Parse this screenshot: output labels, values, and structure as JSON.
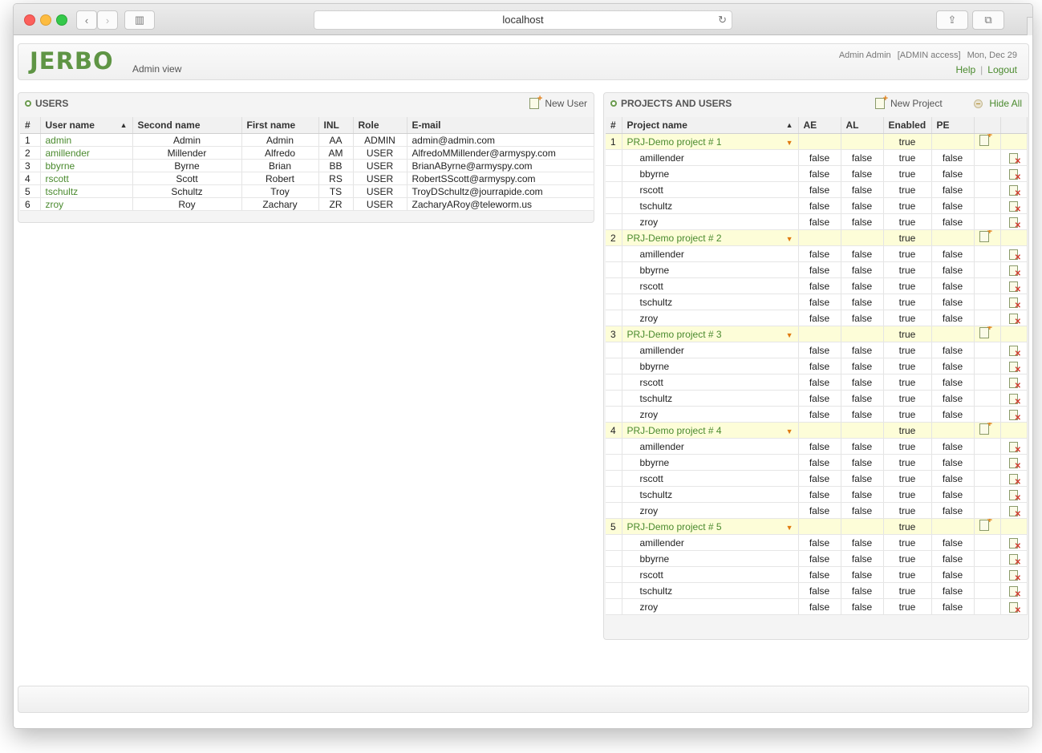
{
  "browser": {
    "url": "localhost"
  },
  "header": {
    "logo": "JERBO",
    "view_label": "Admin view",
    "user_name": "Admin Admin",
    "access": "[ADMIN access]",
    "date": "Mon, Dec 29",
    "help_label": "Help",
    "separator": "|",
    "logout_label": "Logout"
  },
  "users_panel": {
    "title": "USERS",
    "new_user_label": "New User",
    "columns": [
      "#",
      "User name",
      "Second name",
      "First name",
      "INL",
      "Role",
      "E-mail"
    ],
    "rows": [
      [
        "1",
        "admin",
        "Admin",
        "Admin",
        "AA",
        "ADMIN",
        "admin@admin.com"
      ],
      [
        "2",
        "amillender",
        "Millender",
        "Alfredo",
        "AM",
        "USER",
        "AlfredoMMillender@armyspy.com"
      ],
      [
        "3",
        "bbyrne",
        "Byrne",
        "Brian",
        "BB",
        "USER",
        "BrianAByrne@armyspy.com"
      ],
      [
        "4",
        "rscott",
        "Scott",
        "Robert",
        "RS",
        "USER",
        "RobertSScott@armyspy.com"
      ],
      [
        "5",
        "tschultz",
        "Schultz",
        "Troy",
        "TS",
        "USER",
        "TroyDSchultz@jourrapide.com"
      ],
      [
        "6",
        "zroy",
        "Roy",
        "Zachary",
        "ZR",
        "USER",
        "ZacharyARoy@teleworm.us"
      ]
    ]
  },
  "projects_panel": {
    "title": "PROJECTS AND USERS",
    "new_project_label": "New Project",
    "hide_all_label": "Hide All",
    "columns": [
      "#",
      "Project name",
      "AE",
      "AL",
      "Enabled",
      "PE",
      "",
      ""
    ],
    "projects": [
      {
        "num": "1",
        "name": "PRJ-Demo project # 1",
        "enabled": "true",
        "members": [
          [
            "amillender",
            "false",
            "false",
            "true",
            "false"
          ],
          [
            "bbyrne",
            "false",
            "false",
            "true",
            "false"
          ],
          [
            "rscott",
            "false",
            "false",
            "true",
            "false"
          ],
          [
            "tschultz",
            "false",
            "false",
            "true",
            "false"
          ],
          [
            "zroy",
            "false",
            "false",
            "true",
            "false"
          ]
        ]
      },
      {
        "num": "2",
        "name": "PRJ-Demo project # 2",
        "enabled": "true",
        "members": [
          [
            "amillender",
            "false",
            "false",
            "true",
            "false"
          ],
          [
            "bbyrne",
            "false",
            "false",
            "true",
            "false"
          ],
          [
            "rscott",
            "false",
            "false",
            "true",
            "false"
          ],
          [
            "tschultz",
            "false",
            "false",
            "true",
            "false"
          ],
          [
            "zroy",
            "false",
            "false",
            "true",
            "false"
          ]
        ]
      },
      {
        "num": "3",
        "name": "PRJ-Demo project # 3",
        "enabled": "true",
        "members": [
          [
            "amillender",
            "false",
            "false",
            "true",
            "false"
          ],
          [
            "bbyrne",
            "false",
            "false",
            "true",
            "false"
          ],
          [
            "rscott",
            "false",
            "false",
            "true",
            "false"
          ],
          [
            "tschultz",
            "false",
            "false",
            "true",
            "false"
          ],
          [
            "zroy",
            "false",
            "false",
            "true",
            "false"
          ]
        ]
      },
      {
        "num": "4",
        "name": "PRJ-Demo project # 4",
        "enabled": "true",
        "members": [
          [
            "amillender",
            "false",
            "false",
            "true",
            "false"
          ],
          [
            "bbyrne",
            "false",
            "false",
            "true",
            "false"
          ],
          [
            "rscott",
            "false",
            "false",
            "true",
            "false"
          ],
          [
            "tschultz",
            "false",
            "false",
            "true",
            "false"
          ],
          [
            "zroy",
            "false",
            "false",
            "true",
            "false"
          ]
        ]
      },
      {
        "num": "5",
        "name": "PRJ-Demo project # 5",
        "enabled": "true",
        "members": [
          [
            "amillender",
            "false",
            "false",
            "true",
            "false"
          ],
          [
            "bbyrne",
            "false",
            "false",
            "true",
            "false"
          ],
          [
            "rscott",
            "false",
            "false",
            "true",
            "false"
          ],
          [
            "tschultz",
            "false",
            "false",
            "true",
            "false"
          ],
          [
            "zroy",
            "false",
            "false",
            "true",
            "false"
          ]
        ]
      }
    ]
  },
  "colors": {
    "brand_green": "#5f9545",
    "link_green": "#4a8a2e",
    "project_row": "#fdfdd8",
    "add_accent": "#e07a10",
    "delete_red": "#d23b2e"
  }
}
